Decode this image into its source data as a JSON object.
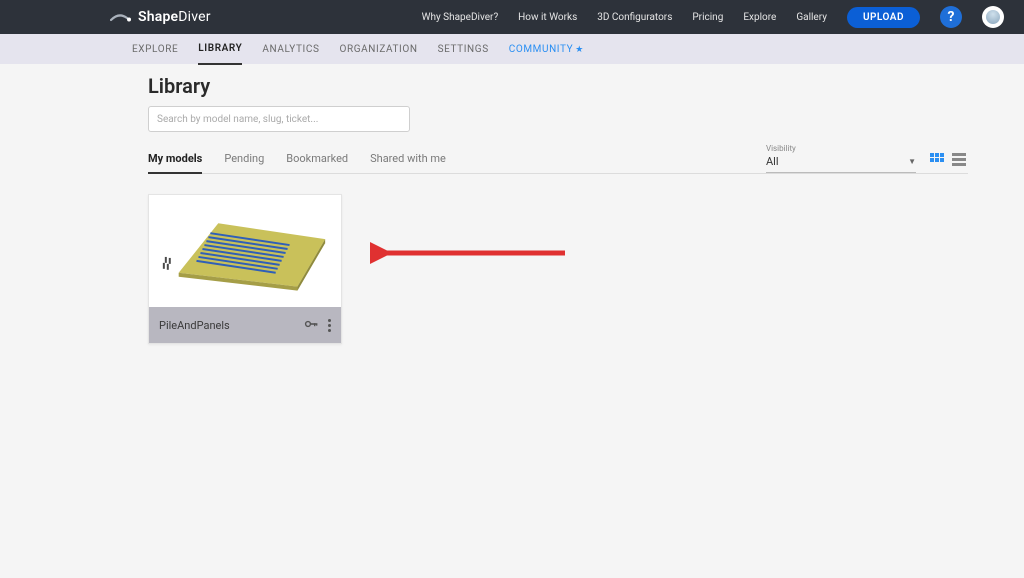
{
  "brand": {
    "name_prefix": "Shape",
    "name_suffix": "Diver"
  },
  "topnav": {
    "items": [
      "Why ShapeDiver?",
      "How it Works",
      "3D Configurators",
      "Pricing",
      "Explore",
      "Gallery"
    ],
    "upload": "UPLOAD"
  },
  "secnav": {
    "items": [
      "EXPLORE",
      "LIBRARY",
      "ANALYTICS",
      "ORGANIZATION",
      "SETTINGS"
    ],
    "community": "COMMUNITY",
    "active": "LIBRARY"
  },
  "page": {
    "title": "Library",
    "search_placeholder": "Search by model name, slug, ticket..."
  },
  "tabs": {
    "items": [
      "My models",
      "Pending",
      "Bookmarked",
      "Shared with me"
    ],
    "active": "My models"
  },
  "visibility": {
    "label": "Visibility",
    "value": "All"
  },
  "card": {
    "title": "PileAndPanels"
  },
  "help": "?"
}
